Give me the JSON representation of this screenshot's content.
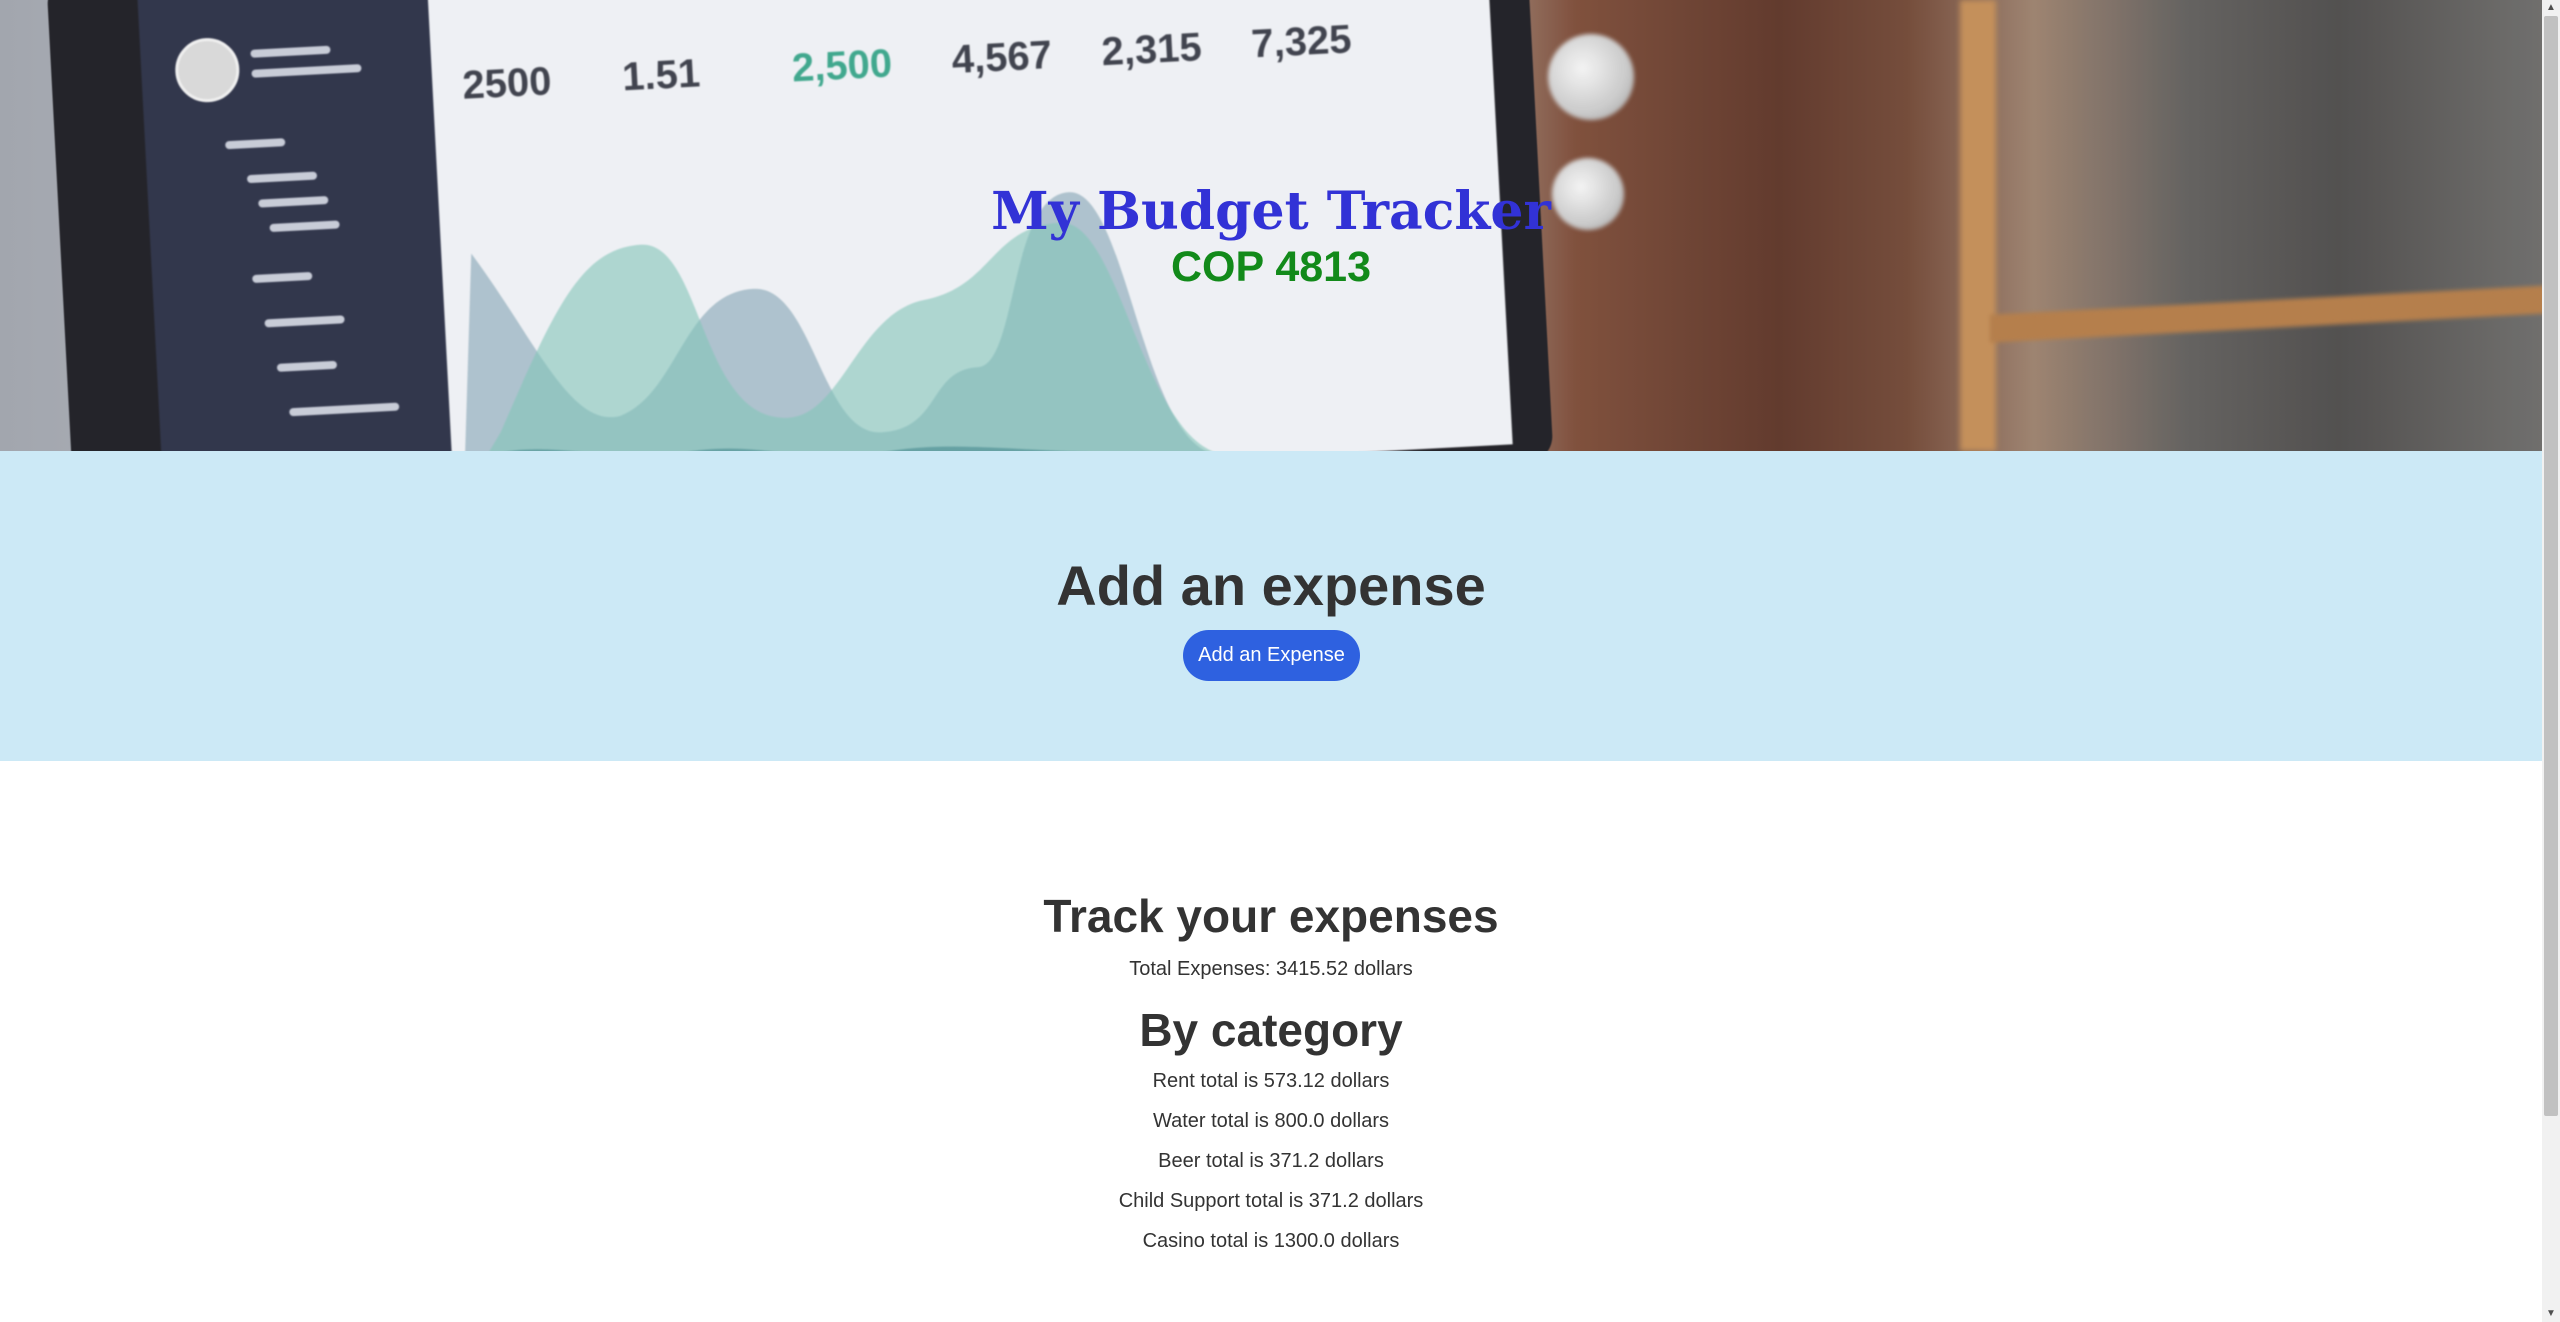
{
  "hero": {
    "title": "My Budget Tracker",
    "subtitle": "COP 4813",
    "background_image": "laptop-dashboard-photo"
  },
  "add_expense": {
    "heading": "Add an expense",
    "button_label": "Add an Expense"
  },
  "track": {
    "heading": "Track your expenses",
    "total_line": "Total Expenses: 3415.52 dollars",
    "category_heading": "By category",
    "categories": [
      "Rent total is 573.12 dollars",
      "Water total is 800.0 dollars",
      "Beer total is 371.2 dollars",
      "Child Support total is 371.2 dollars",
      "Casino total is 1300.0 dollars"
    ]
  },
  "colors": {
    "hero_title": "#3232d6",
    "hero_subtitle": "#128a1a",
    "add_section_bg": "#cce9f6",
    "button_bg": "#2e61e0"
  },
  "icons": {
    "scroll_up": "▲",
    "scroll_down": "▼"
  }
}
